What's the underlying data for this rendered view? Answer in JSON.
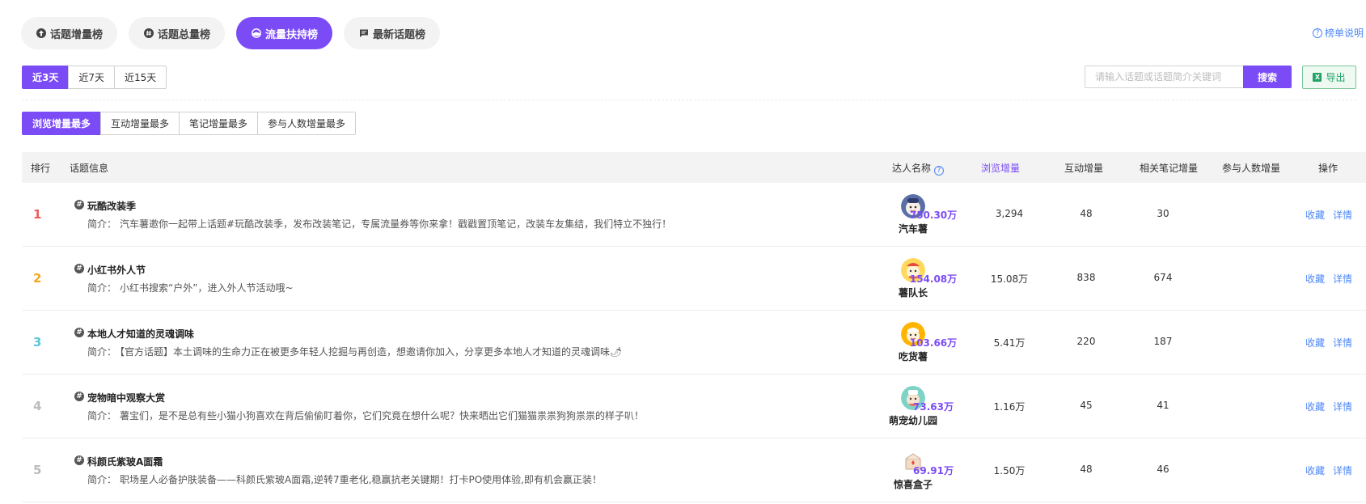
{
  "top_tabs": [
    {
      "label": "话题增量榜",
      "icon": "arrow-up-circle-icon",
      "active": false
    },
    {
      "label": "话题总量榜",
      "icon": "hash-circle-icon",
      "active": false
    },
    {
      "label": "流量扶持榜",
      "icon": "gauge-icon",
      "active": true
    },
    {
      "label": "最新话题榜",
      "icon": "message-square-icon",
      "active": false
    }
  ],
  "help_link": "榜单说明",
  "day_ranges": [
    {
      "label": "近3天",
      "active": true
    },
    {
      "label": "近7天",
      "active": false
    },
    {
      "label": "近15天",
      "active": false
    }
  ],
  "metric_tabs": [
    {
      "label": "浏览增量最多",
      "active": true
    },
    {
      "label": "互动增量最多",
      "active": false
    },
    {
      "label": "笔记增量最多",
      "active": false
    },
    {
      "label": "参与人数增量最多",
      "active": false
    }
  ],
  "search": {
    "placeholder": "请输入话题或话题简介关键词",
    "button": "搜索"
  },
  "export": {
    "label": "导出"
  },
  "columns": {
    "rank": "排行",
    "topic": "话题信息",
    "kol": "达人名称",
    "views": "浏览增量",
    "interactions": "互动增量",
    "notes": "相关笔记增量",
    "participants": "参与人数增量",
    "actions": "操作"
  },
  "desc_label": "简介：",
  "actions": {
    "favorite": "收藏",
    "detail": "详情"
  },
  "rows": [
    {
      "rank": "1",
      "rank_color": "#f05a5a",
      "title": "玩酷改装季",
      "desc": "汽车薯邀你一起带上话题#玩酷改装季，发布改装笔记，专属流量券等你来拿！戳戳置顶笔记，改装车友集结，我们特立不独行！",
      "kol": "汽车薯",
      "views": "750.30万",
      "interactions": "3,294",
      "notes": "48",
      "participants": "30"
    },
    {
      "rank": "2",
      "rank_color": "#f5a623",
      "title": "小红书外人节",
      "desc": "小红书搜索“户外”，进入外人节活动哦~",
      "kol": "薯队长",
      "views": "154.08万",
      "interactions": "15.08万",
      "notes": "838",
      "participants": "674"
    },
    {
      "rank": "3",
      "rank_color": "#5ec4d6",
      "title": "本地人才知道的灵魂调味",
      "desc": "【官方话题】本土调味的生命力正在被更多年轻人挖掘与再创造，想邀请你加入，分享更多本地人才知道的灵魂调味🌶",
      "kol": "吃货薯",
      "views": "103.66万",
      "interactions": "5.41万",
      "notes": "220",
      "participants": "187"
    },
    {
      "rank": "4",
      "rank_color": "#bbbbbb",
      "title": "宠物暗中观察大赏",
      "desc": "薯宝们，是不是总有些小猫小狗喜欢在背后偷偷盯着你，它们究竟在想什么呢？快来晒出它们猫猫祟祟狗狗祟祟的样子叭！",
      "kol": "萌宠幼儿园",
      "views": "73.63万",
      "interactions": "1.16万",
      "notes": "45",
      "participants": "41"
    },
    {
      "rank": "5",
      "rank_color": "#bbbbbb",
      "title": "科颜氏紫玻A面霜",
      "desc": "职场星人必备护肤装备——科颜氏紫玻A面霜,逆转7重老化,稳赢抗老关键期！打卡PO使用体验,即有机会赢正装！",
      "kol": "惊喜盒子",
      "views": "69.91万",
      "interactions": "1.50万",
      "notes": "48",
      "participants": "46"
    }
  ]
}
